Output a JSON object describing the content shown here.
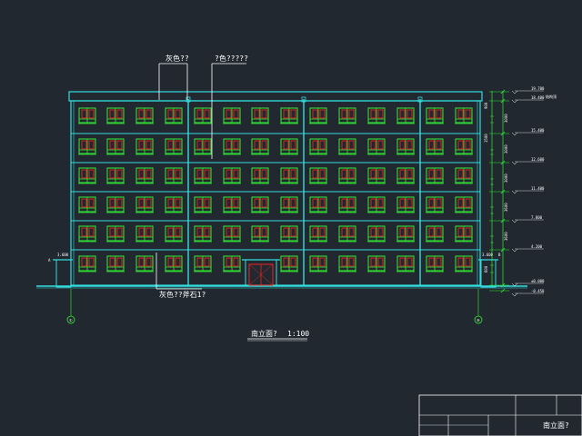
{
  "colors": {
    "background": "#212830",
    "outline": "#33dddd",
    "window_frame": "#33ee33",
    "window_glass": "#ee2222",
    "dimension": "#33ee33",
    "text": "#ffffff",
    "leader": "#ffffff"
  },
  "drawing": {
    "callout_top_left": "灰色??",
    "callout_top_right": "?色?????",
    "callout_bottom": "灰色??斧石1?",
    "title": "南立面?",
    "scale": "1:100",
    "axis_left": "①",
    "axis_right": "⑨",
    "left_porch_elev": "3.600",
    "right_porch_elev": "3.600",
    "side_marks": [
      "A",
      "B"
    ]
  },
  "elevations": {
    "labels": [
      "19.700",
      "18.400",
      "15.400",
      "12.600",
      "11.400",
      "7.800",
      "4.200",
      "±0.000",
      "-0.450"
    ],
    "roof_note": "结构顶"
  },
  "dimensions": {
    "storey_labels": [
      "3000",
      "3000",
      "3000",
      "3600",
      "3600"
    ],
    "small_labels": [
      "900",
      "1500",
      "600"
    ]
  },
  "title_block": {
    "drawing_name": "南立面?"
  }
}
